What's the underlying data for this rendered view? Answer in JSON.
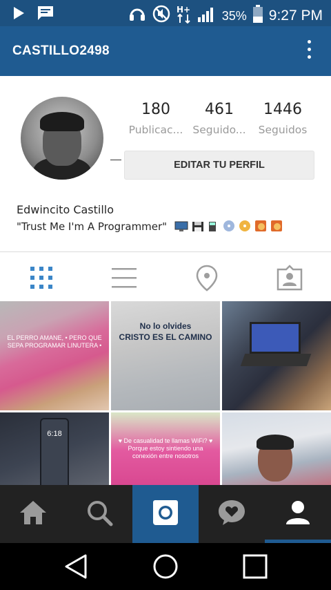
{
  "status_bar": {
    "battery_pct": "35%",
    "time": "9:27 PM",
    "icons": [
      "play-icon",
      "message-icon",
      "headset-icon",
      "mute-icon",
      "data-hplus-icon",
      "signal-icon",
      "battery-icon"
    ]
  },
  "app_bar": {
    "username": "CASTILLO2498",
    "menu_icon": "more-vert-icon"
  },
  "profile": {
    "stats": [
      {
        "value": "180",
        "label": "Publicac..."
      },
      {
        "value": "461",
        "label": "Seguido..."
      },
      {
        "value": "1446",
        "label": "Seguidos"
      }
    ],
    "edit_button": "EDITAR TU PERFIL",
    "name": "Edwincito Castillo",
    "bio": "\"Trust Me I'm A Programmer\"",
    "bio_emoji": [
      "computer-icon",
      "floppy-disk-icon",
      "calculator-icon",
      "cd-icon",
      "dvd-icon",
      "media-icon",
      "media-icon"
    ]
  },
  "view_tabs": [
    {
      "icon": "grid-icon",
      "active": true
    },
    {
      "icon": "list-icon",
      "active": false
    },
    {
      "icon": "location-pin-icon",
      "active": false
    },
    {
      "icon": "tagged-photos-icon",
      "active": false
    }
  ],
  "grid": {
    "tiles": [
      {
        "caption": "EL PERRO AMANE,\n• PERO QUE SEPA PROGRAMAR LINUTERA •"
      },
      {
        "caption": "No lo olvides\nCRISTO ES EL CAMINO"
      },
      {
        "caption": ""
      },
      {
        "caption": "6:18"
      },
      {
        "caption": "♥ De casualidad te llamas WiFi? ♥\nPorque estoy sintiendo una conexión entre nosotros"
      },
      {
        "caption": ""
      }
    ]
  },
  "bottom_nav": [
    {
      "icon": "home-icon",
      "active": false
    },
    {
      "icon": "search-icon",
      "active": false
    },
    {
      "icon": "camera-icon",
      "active": false
    },
    {
      "icon": "activity-heart-icon",
      "active": false
    },
    {
      "icon": "profile-icon",
      "active": true
    }
  ],
  "android_nav": [
    "back-icon",
    "home-circle-icon",
    "recents-icon"
  ],
  "colors": {
    "brand_blue": "#1f5b91",
    "status_bar_blue": "#1d5180",
    "grid_icon_blue": "#3b86c8",
    "nav_bg": "#222222"
  }
}
